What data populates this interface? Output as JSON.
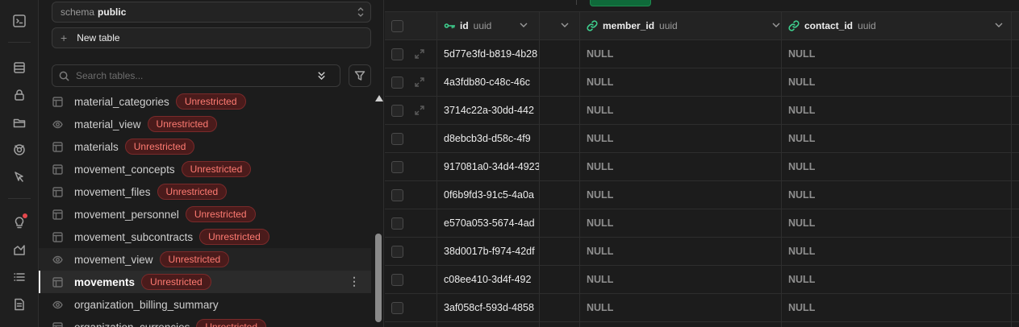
{
  "rail": {
    "icons": [
      "terminal-icon",
      "database-icon",
      "lock-icon",
      "folder-icon",
      "realtime-icon",
      "pointer-icon",
      "lightbulb-icon",
      "reports-icon",
      "list-icon",
      "docs-icon"
    ]
  },
  "sidebar": {
    "schema": {
      "label": "schema",
      "value": "public"
    },
    "new_table_label": "New table",
    "search_placeholder": "Search tables...",
    "tables": [
      {
        "name": "material_categories",
        "kind": "table",
        "badge": "Unrestricted"
      },
      {
        "name": "material_view",
        "kind": "view",
        "badge": "Unrestricted"
      },
      {
        "name": "materials",
        "kind": "table",
        "badge": "Unrestricted"
      },
      {
        "name": "movement_concepts",
        "kind": "table",
        "badge": "Unrestricted"
      },
      {
        "name": "movement_files",
        "kind": "table",
        "badge": "Unrestricted"
      },
      {
        "name": "movement_personnel",
        "kind": "table",
        "badge": "Unrestricted"
      },
      {
        "name": "movement_subcontracts",
        "kind": "table",
        "badge": "Unrestricted"
      },
      {
        "name": "movement_view",
        "kind": "view",
        "badge": "Unrestricted"
      },
      {
        "name": "movements",
        "kind": "table",
        "badge": "Unrestricted",
        "active": true
      },
      {
        "name": "organization_billing_summary",
        "kind": "view",
        "badge": ""
      },
      {
        "name": "organization_currencies",
        "kind": "table",
        "badge": "Unrestricted"
      }
    ]
  },
  "grid": {
    "columns": [
      {
        "name": "id",
        "type": "uuid",
        "icon": "key-icon"
      },
      {
        "name": "member_id",
        "type": "uuid",
        "icon": "link-icon"
      },
      {
        "name": "contact_id",
        "type": "uuid",
        "icon": "link-icon"
      }
    ],
    "rows": [
      {
        "id": "5d77e3fd-b819-4b28",
        "member_id": "NULL",
        "contact_id": "NULL"
      },
      {
        "id": "4a3fdb80-c48c-46c",
        "member_id": "NULL",
        "contact_id": "NULL"
      },
      {
        "id": "3714c22a-30dd-442",
        "member_id": "NULL",
        "contact_id": "NULL"
      },
      {
        "id": "d8ebcb3d-d58c-4f9",
        "member_id": "NULL",
        "contact_id": "NULL"
      },
      {
        "id": "917081a0-34d4-4923",
        "member_id": "NULL",
        "contact_id": "NULL"
      },
      {
        "id": "0f6b9fd3-91c5-4a0a",
        "member_id": "NULL",
        "contact_id": "NULL"
      },
      {
        "id": "e570a053-5674-4ad",
        "member_id": "NULL",
        "contact_id": "NULL"
      },
      {
        "id": "38d0017b-f974-42df",
        "member_id": "NULL",
        "contact_id": "NULL"
      },
      {
        "id": "c08ee410-3d4f-492",
        "member_id": "NULL",
        "contact_id": "NULL"
      },
      {
        "id": "3af058cf-593d-4858",
        "member_id": "NULL",
        "contact_id": "NULL"
      }
    ]
  },
  "colors": {
    "accent_green": "#3ecf8e",
    "badge_red": "#ff7b72",
    "link_icon": "#3ecf8e"
  }
}
